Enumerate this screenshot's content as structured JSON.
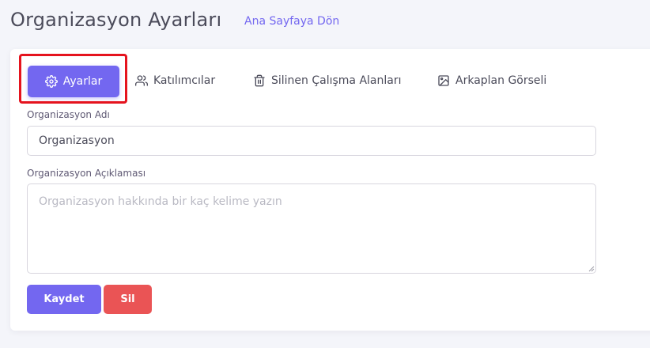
{
  "header": {
    "title": "Organizasyon Ayarları",
    "back_link": "Ana Sayfaya Dön"
  },
  "tabs": [
    {
      "label": "Ayarlar",
      "icon": "gear-icon",
      "active": true
    },
    {
      "label": "Katılımcılar",
      "icon": "users-icon",
      "active": false
    },
    {
      "label": "Silinen Çalışma Alanları",
      "icon": "trash-icon",
      "active": false
    },
    {
      "label": "Arkaplan Görseli",
      "icon": "image-icon",
      "active": false
    }
  ],
  "form": {
    "name_label": "Organizasyon Adı",
    "name_value": "Organizasyon",
    "description_label": "Organizasyon Açıklaması",
    "description_placeholder": "Organizasyon hakkında bir kaç kelime yazın"
  },
  "actions": {
    "save_label": "Kaydet",
    "delete_label": "Sil"
  },
  "colors": {
    "primary": "#7367f0",
    "danger": "#ea5455",
    "highlight": "#e5131e"
  }
}
